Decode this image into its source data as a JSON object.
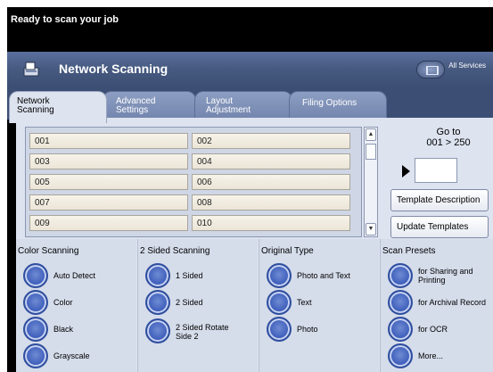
{
  "status": {
    "message": "Ready to scan your job"
  },
  "header": {
    "title": "Network Scanning",
    "icon": "scanner-icon",
    "all_services_label": "All Services",
    "all_services_icon": "all-services-icon"
  },
  "tabs": [
    {
      "line1": "Network",
      "line2": "Scanning",
      "active": true
    },
    {
      "line1": "Advanced",
      "line2": "Settings",
      "active": false
    },
    {
      "line1": "Layout",
      "line2": "Adjustment",
      "active": false
    },
    {
      "line1": "Filing Options",
      "line2": "",
      "active": false
    }
  ],
  "templates": [
    "001",
    "002",
    "003",
    "004",
    "005",
    "006",
    "007",
    "008",
    "009",
    "010"
  ],
  "goto": {
    "label": "Go to",
    "range": "001 > 250",
    "value": ""
  },
  "buttons": {
    "template_description": "Template Description",
    "update_templates": "Update Templates"
  },
  "groups": [
    {
      "title": "Color Scanning",
      "options": [
        "Auto Detect",
        "Color",
        "Black",
        "Grayscale"
      ]
    },
    {
      "title": "2 Sided Scanning",
      "options": [
        "1 Sided",
        "2 Sided",
        "2 Sided Rotate Side 2"
      ]
    },
    {
      "title": "Original Type",
      "options": [
        "Photo and Text",
        "Text",
        "Photo"
      ]
    },
    {
      "title": "Scan Presets",
      "options": [
        "for Sharing and Printing",
        "for Archival Record",
        "for OCR",
        "More..."
      ]
    }
  ],
  "colors": {
    "header": "#46597f",
    "tab_inactive": "#7f90b7",
    "panel": "#dde3ef",
    "radio": "#3f5fbb"
  }
}
